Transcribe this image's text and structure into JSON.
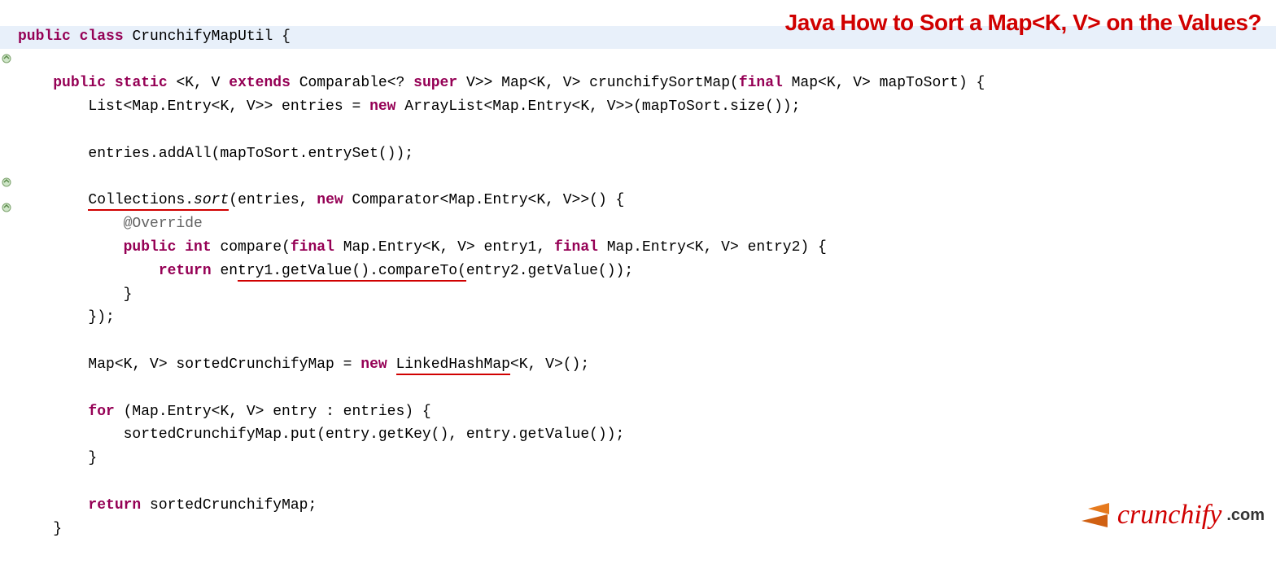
{
  "title": "Java How to Sort a Map<K, V> on the Values?",
  "logo": {
    "name": "crunchify",
    "suffix": ".com"
  },
  "code": {
    "l1_public": "public",
    "l1_class": "class",
    "l1_name": " CrunchifyMapUtil {",
    "l3_public": "public",
    "l3_static": "static",
    "l3_gen1": " <K, V ",
    "l3_extends": "extends",
    "l3_gen2": " Comparable<? ",
    "l3_super": "super",
    "l3_gen3": " V>> Map<K, V> crunchifySortMap(",
    "l3_final": "final",
    "l3_gen4": " Map<K, V> mapToSort) {",
    "l4": "        List<Map.Entry<K, V>> entries = ",
    "l4_new": "new",
    "l4_rest": " ArrayList<Map.Entry<K, V>>(mapToSort.size());",
    "l6": "        entries.addAll(mapToSort.entrySet());",
    "l8a": "        ",
    "l8_coll": "Collections.",
    "l8_sort": "sort",
    "l8b": "(entries, ",
    "l8_new": "new",
    "l8c": " Comparator<Map.Entry<K, V>>() {",
    "l9_ann": "@Override",
    "l10_public": "public",
    "l10_int": "int",
    "l10a": " compare(",
    "l10_final1": "final",
    "l10b": " Map.Entry<K, V> entry1, ",
    "l10_final2": "final",
    "l10c": " Map.Entry<K, V> entry2) {",
    "l11_return": "return",
    "l11a": " en",
    "l11_u": "try1.getValue().compareTo(",
    "l11b": "entry2.getValue());",
    "l12": "            }",
    "l13": "        });",
    "l15a": "        Map<K, V> sortedCrunchifyMap = ",
    "l15_new": "new",
    "l15b": " ",
    "l15_u": "LinkedHashMap",
    "l15c": "<K, V>();",
    "l17_for": "for",
    "l17a": " (Map.Entry<K, V> entry : entries) {",
    "l18": "            sortedCrunchifyMap.put(entry.getKey(), entry.getValue());",
    "l19": "        }",
    "l21_return": "return",
    "l21a": " sortedCrunchifyMap;",
    "l22": "    }"
  }
}
